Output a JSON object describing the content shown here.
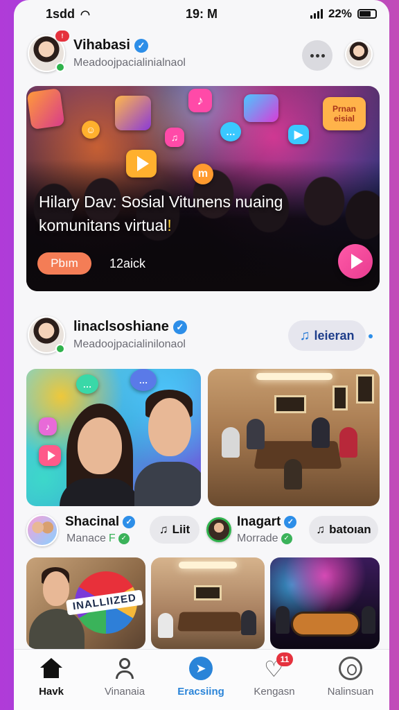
{
  "status_bar": {
    "carrier": "1sdd",
    "time": "19: M",
    "battery": "22%"
  },
  "header": {
    "name": "Vihabasi",
    "subtitle": "Meadoojpacialinialnaol",
    "notif_count": "!"
  },
  "hero": {
    "title": "Hilary Dav: Sosial Vitunens nuaing komunitans virtual",
    "title_spark": "!",
    "button_label": "Pbım",
    "count": "12aick",
    "bubble_text": "Prnan eisial"
  },
  "post": {
    "name": "linaclsoshiane",
    "subtitle": "Meadoojpacialinilonaol",
    "action_label": "leieran"
  },
  "mini_users": [
    {
      "name": "Shacinal",
      "subtitle": "Manace",
      "sub_suffix": "F",
      "action_label": "Liit"
    },
    {
      "name": "Inagart",
      "subtitle": "Morrade",
      "action_label": "batoıan"
    }
  ],
  "card_c": {
    "ball_text": "INALLIIZED"
  },
  "tabs": [
    {
      "label": "Havk",
      "icon": "home-icon"
    },
    {
      "label": "Vinanaia",
      "icon": "profile-icon"
    },
    {
      "label": "Eracsiing",
      "icon": "send-icon"
    },
    {
      "label": "Kengasn",
      "icon": "heart-icon",
      "badge": "11"
    },
    {
      "label": "Nalinsuan",
      "icon": "face-icon"
    }
  ],
  "colors": {
    "accent": "#2a84d8",
    "verified": "#2d8ee8",
    "badge": "#e5323e",
    "hero_button": "#f47d56"
  }
}
